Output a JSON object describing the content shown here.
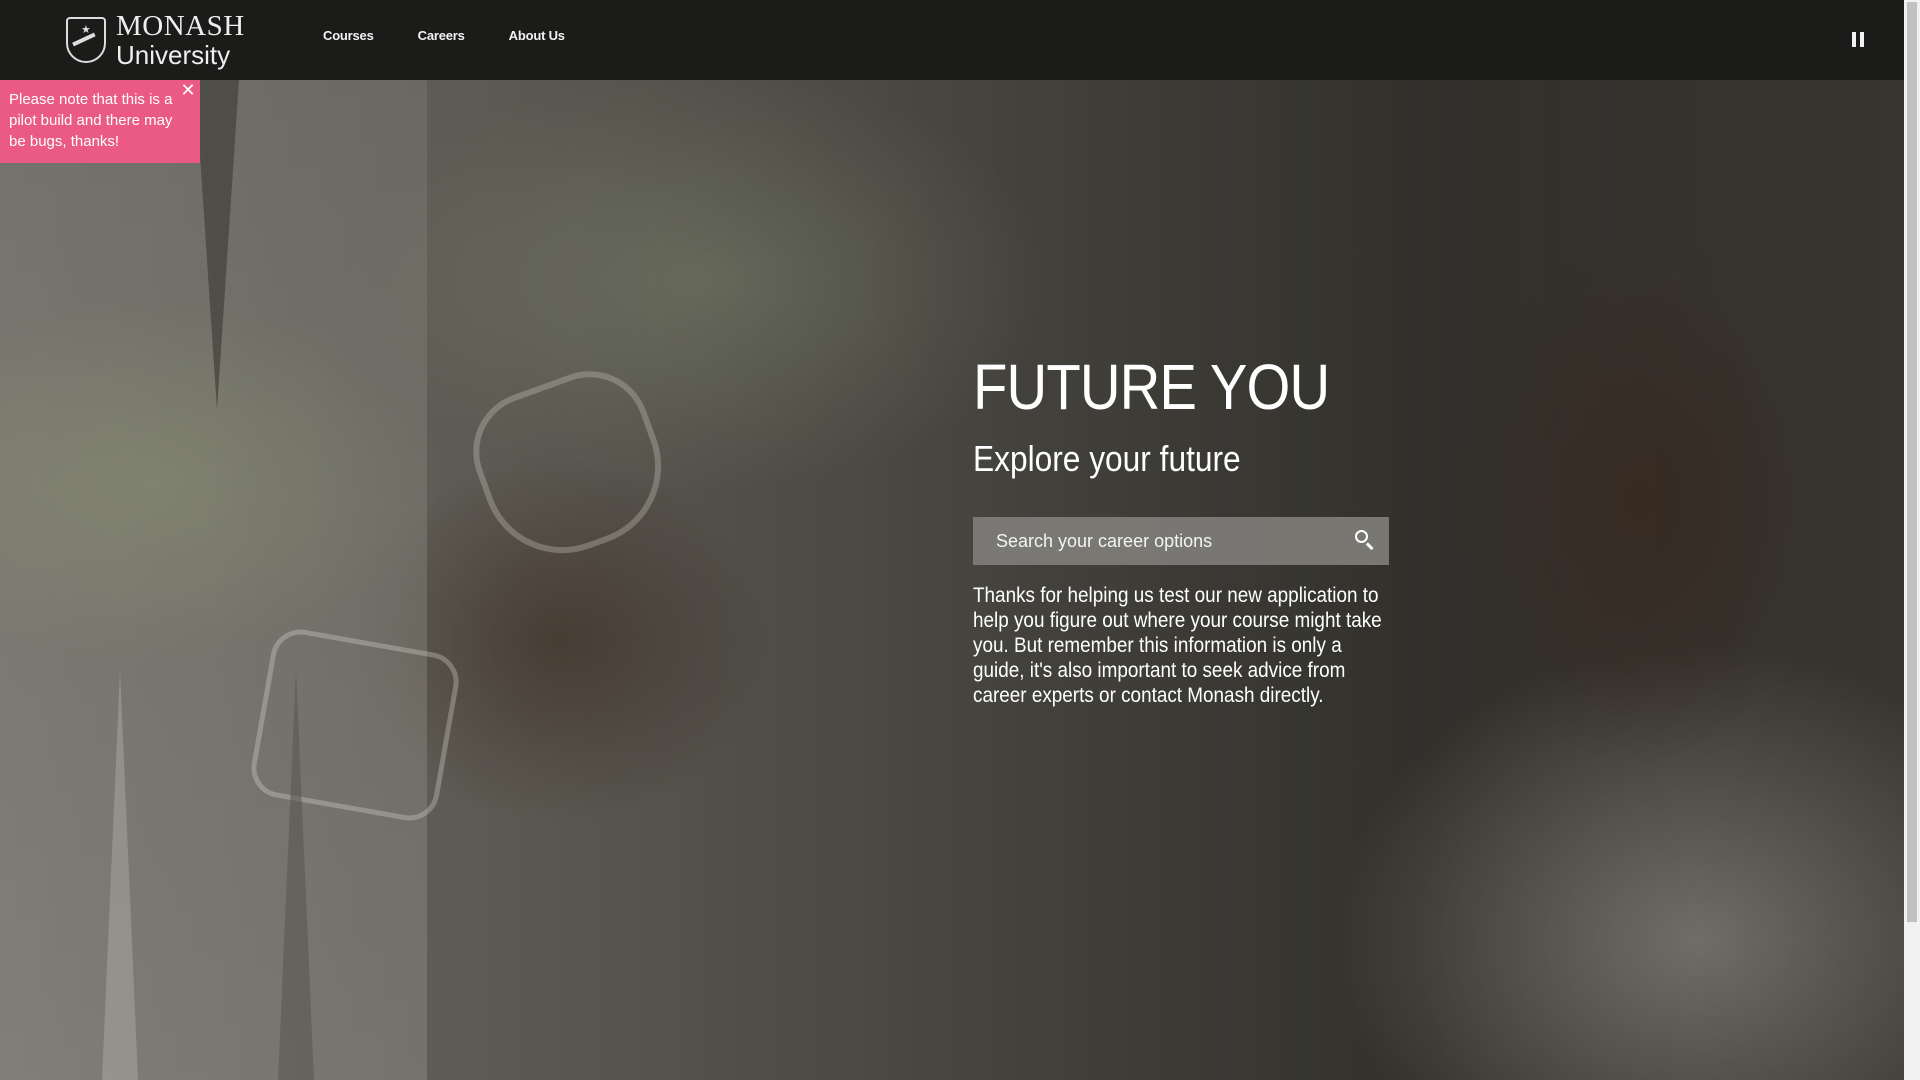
{
  "header": {
    "logo": {
      "line1": "MONASH",
      "line2": "University"
    },
    "nav": [
      {
        "label": "Courses"
      },
      {
        "label": "Careers"
      },
      {
        "label": "About Us"
      }
    ]
  },
  "notice": {
    "text": "Please note that this is a pilot build and there may be bugs, thanks!",
    "close_icon": "close-icon"
  },
  "hero": {
    "title": "FUTURE YOU",
    "subtitle": "Explore your future",
    "search": {
      "placeholder": "Search your career options",
      "value": "",
      "icon": "search-icon"
    },
    "body": "Thanks for helping us test our new application to help you figure out where your course might take you. But remember this information is only a guide, it's also important to seek advice from career experts or contact Monash directly."
  },
  "controls": {
    "pause_icon": "pause-icon"
  },
  "colors": {
    "header_bg": "#1b1b1a",
    "notice_bg": "#ea5a82",
    "search_bg": "#807e7a"
  }
}
